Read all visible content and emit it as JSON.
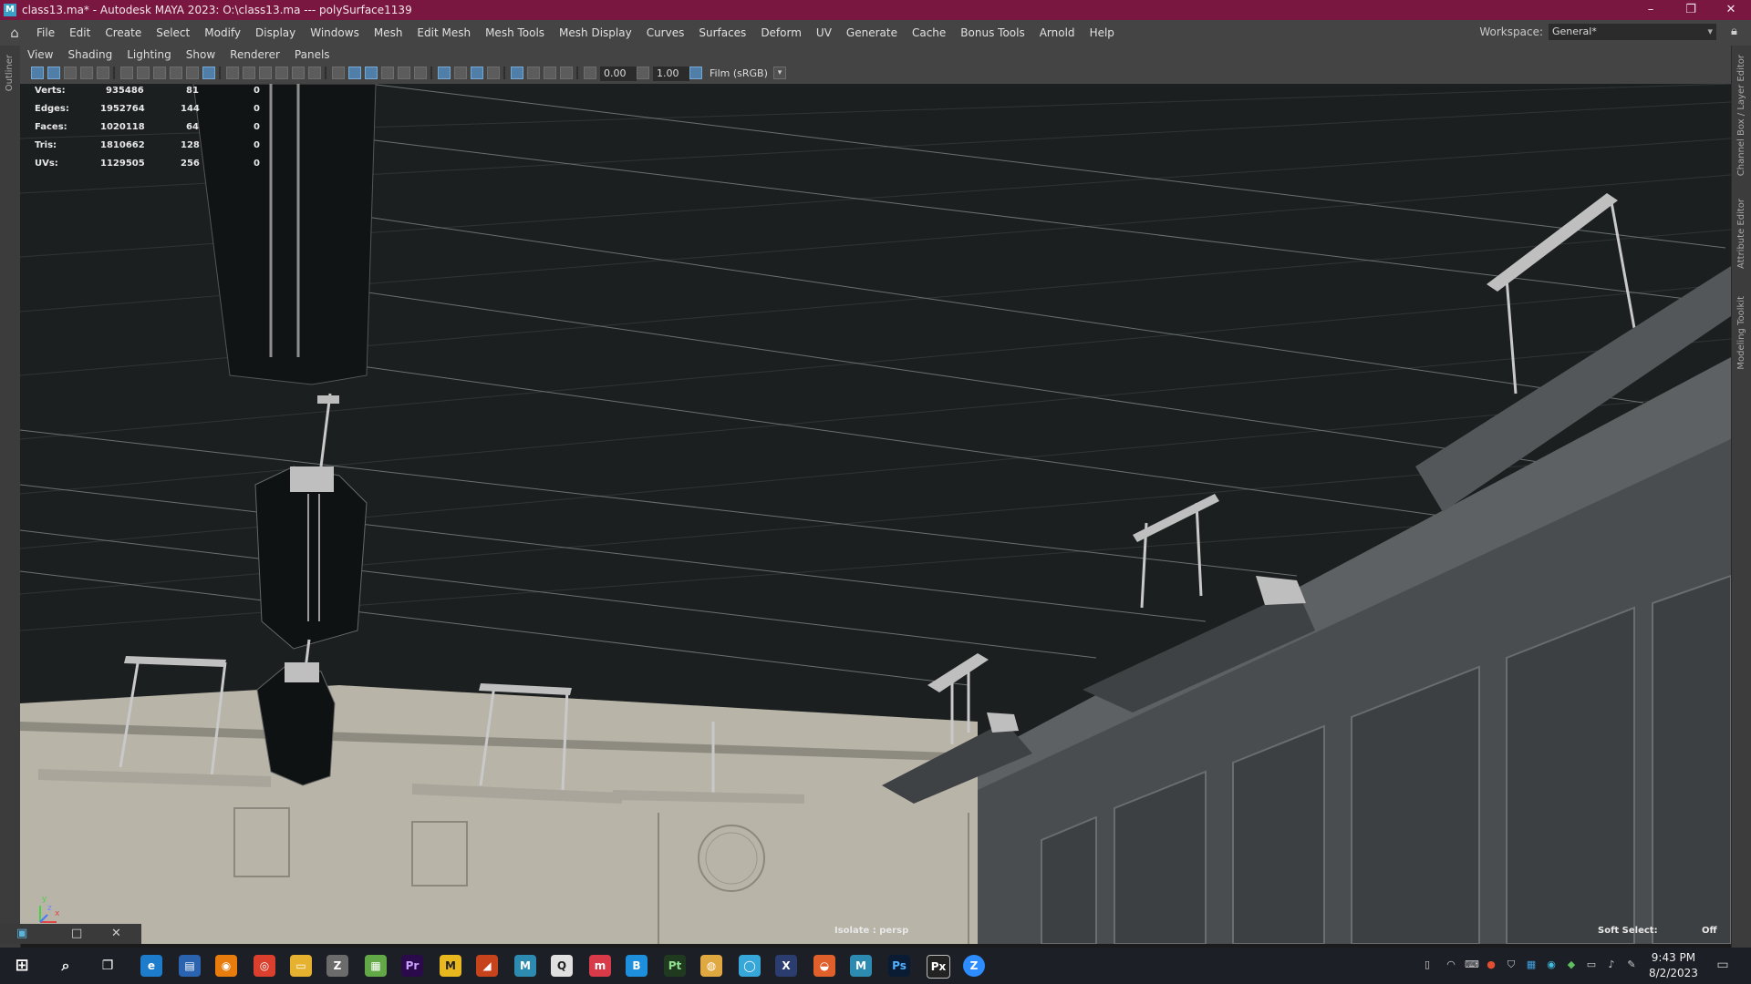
{
  "window": {
    "title": "class13.ma* - Autodesk MAYA 2023: O:\\class13.ma  ---   polySurface1139",
    "minimize": "–",
    "restore": "❐",
    "close": "✕"
  },
  "menus": [
    "File",
    "Edit",
    "Create",
    "Select",
    "Modify",
    "Display",
    "Windows",
    "Mesh",
    "Edit Mesh",
    "Mesh Tools",
    "Mesh Display",
    "Curves",
    "Surfaces",
    "Deform",
    "UV",
    "Generate",
    "Cache",
    "Bonus Tools",
    "Arnold",
    "Help"
  ],
  "workspace": {
    "label": "Workspace:",
    "value": "General*"
  },
  "side_tabs": {
    "left": "Outliner",
    "right1": "Channel Box / Layer Editor",
    "right2": "Attribute Editor",
    "right3": "Modeling Toolkit"
  },
  "panel_menus": [
    "View",
    "Shading",
    "Lighting",
    "Show",
    "Renderer",
    "Panels"
  ],
  "toolbar": {
    "exposure": "0.00",
    "gamma": "1.00",
    "color_space": "Film (sRGB)"
  },
  "hud": {
    "rows": [
      {
        "label": "Verts:",
        "total": "935486",
        "sel": "81",
        "comp": "0"
      },
      {
        "label": "Edges:",
        "total": "1952764",
        "sel": "144",
        "comp": "0"
      },
      {
        "label": "Faces:",
        "total": "1020118",
        "sel": "64",
        "comp": "0"
      },
      {
        "label": "Tris:",
        "total": "1810662",
        "sel": "128",
        "comp": "0"
      },
      {
        "label": "UVs:",
        "total": "1129505",
        "sel": "256",
        "comp": "0"
      }
    ]
  },
  "viewport": {
    "isolate": "Isolate : persp",
    "soft_select_label": "Soft Select:",
    "soft_select_value": "Off",
    "axis_y": "y",
    "axis_z": "z",
    "axis_x": "x"
  },
  "taskbar": {
    "time": "9:43 PM",
    "date": "8/2/2023",
    "apps": [
      "windows-start",
      "search",
      "task-view",
      "edge",
      "store",
      "blender",
      "chrome",
      "file-explorer",
      "zbrush",
      "maps",
      "premiere",
      "marmoset",
      "app-orange",
      "maya",
      "app-search",
      "app-red",
      "app-blue",
      "painter",
      "app-yellow",
      "app-cyan",
      "app-x",
      "houdini",
      "maya-2",
      "photoshop",
      "pixplant",
      "zoom"
    ]
  },
  "colors": {
    "title_bar": "#7a1740",
    "ui_gray": "#444444",
    "viewport_bg": "#1b1f1f",
    "wall": "#b8b4a8",
    "cabinet": "#4a4d4f"
  }
}
